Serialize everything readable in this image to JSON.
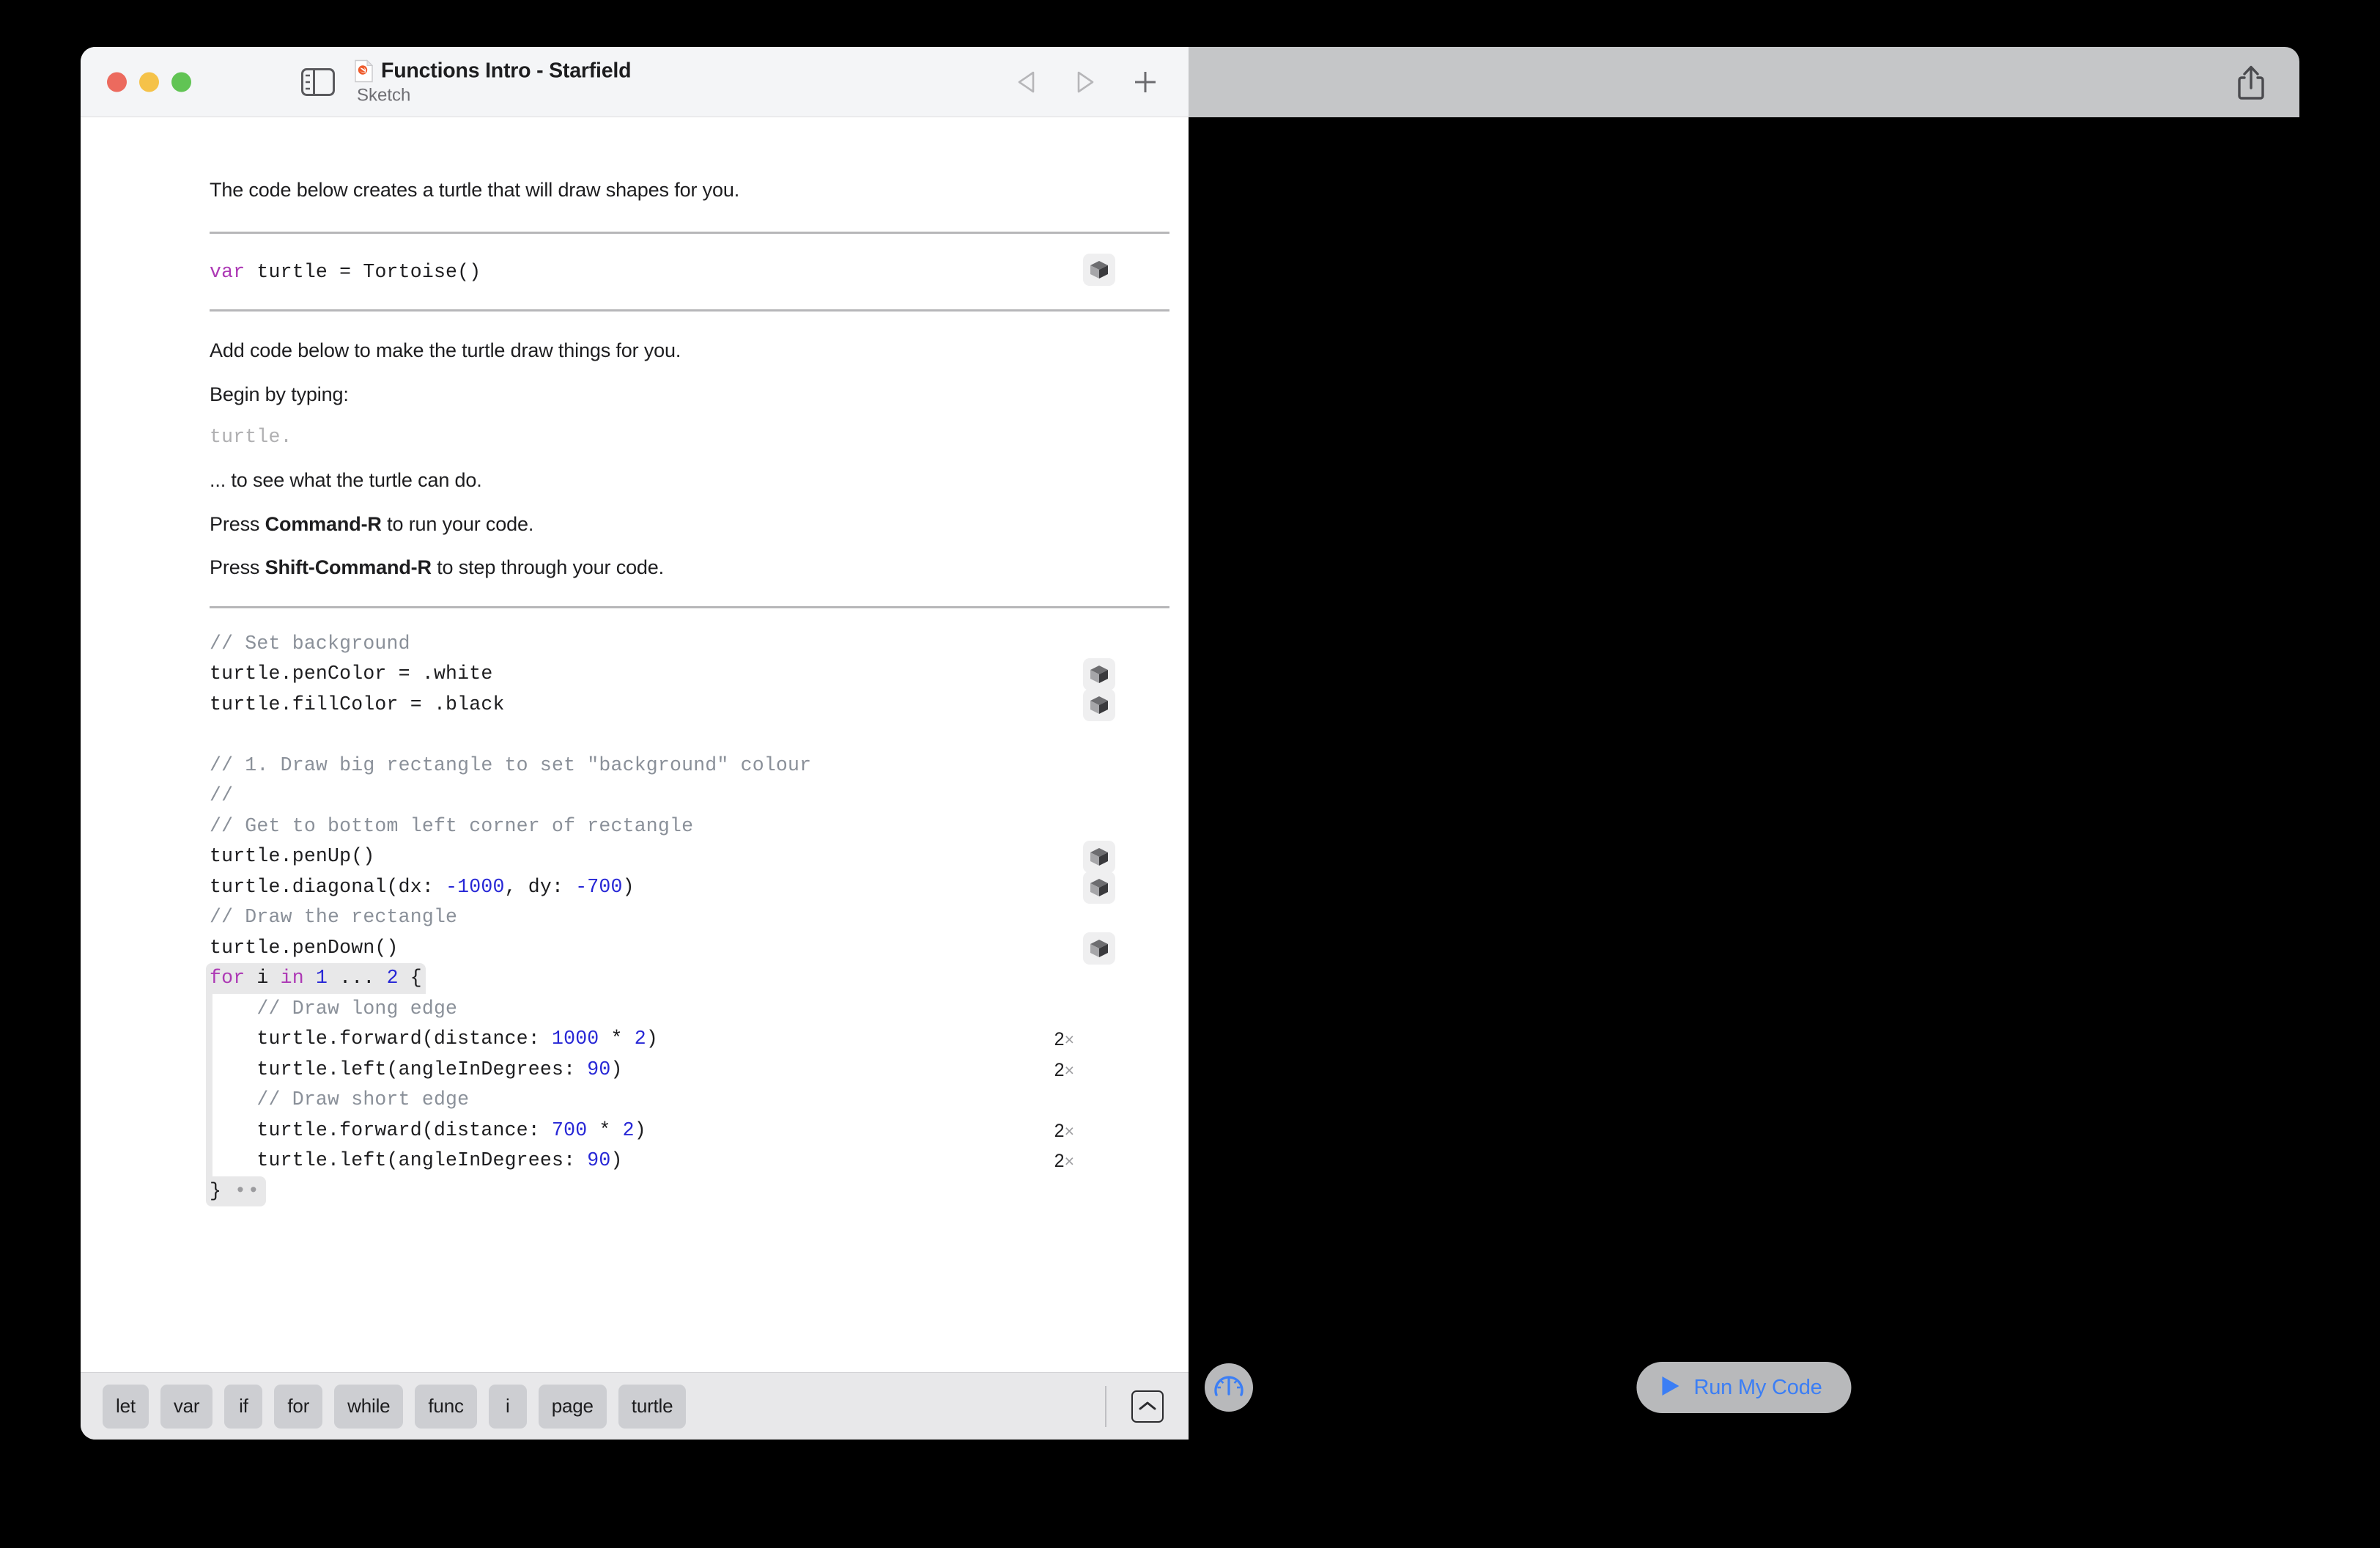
{
  "window": {
    "title": "Functions Intro - Starfield",
    "subtitle": "Sketch",
    "file_icon": "swift-file-icon",
    "traffic_lights": [
      {
        "name": "close",
        "color": "#ec6a5e"
      },
      {
        "name": "minimize",
        "color": "#f5c249"
      },
      {
        "name": "zoom",
        "color": "#61c454"
      }
    ],
    "sidebar_toggle_icon": "sidebar-toggle-icon",
    "nav": [
      {
        "name": "back-icon",
        "glyph": "triangle-left"
      },
      {
        "name": "forward-icon",
        "glyph": "triangle-right"
      },
      {
        "name": "add-icon",
        "glyph": "plus"
      }
    ]
  },
  "document": {
    "intro": "The code below creates a turtle that will draw shapes for you.",
    "setup_code": {
      "keyword": "var",
      "rest": " turtle = Tortoise()"
    },
    "instructions": [
      "Add code below to make the turtle draw things for you.",
      "Begin by typing:"
    ],
    "ghost_hint": "turtle.",
    "after_hint": "... to see what the turtle can do.",
    "run_hint": {
      "prefix": "Press ",
      "shortcut": "Command-R",
      "suffix": " to run your code."
    },
    "step_hint": {
      "prefix": "Press ",
      "shortcut": "Shift-Command-R",
      "suffix": " to step through your code."
    },
    "code_lines": [
      {
        "text": "// Set background",
        "type": "comment"
      },
      {
        "text": "turtle.penColor = .white",
        "type": "code",
        "result": true
      },
      {
        "text": "turtle.fillColor = .black",
        "type": "code",
        "result": true
      },
      {
        "text": "",
        "type": "blank"
      },
      {
        "text": "// 1. Draw big rectangle to set \"background\" colour",
        "type": "comment"
      },
      {
        "text": "//",
        "type": "comment"
      },
      {
        "text": "// Get to bottom left corner of rectangle",
        "type": "comment"
      },
      {
        "text": "turtle.penUp()",
        "type": "code",
        "result": true
      },
      {
        "text": "turtle.diagonal(dx: -1000, dy: -700)",
        "type": "code",
        "result": true
      },
      {
        "text": "// Draw the rectangle",
        "type": "comment"
      },
      {
        "text": "turtle.penDown()",
        "type": "code",
        "result": true
      }
    ],
    "loop": {
      "header": {
        "kw1": "for",
        "var": " i ",
        "kw2": "in",
        "n1": " 1 ",
        "dots": "... ",
        "n2": "2",
        "brace": " {"
      },
      "footer_brace": "}",
      "footer_dots": "••",
      "body": [
        {
          "text": "// Draw long edge",
          "type": "comment",
          "count": ""
        },
        {
          "text": "turtle.forward(distance: 1000 * 2)",
          "type": "code",
          "count": "2"
        },
        {
          "text": "turtle.left(angleInDegrees: 90)",
          "type": "code",
          "count": "2"
        },
        {
          "text": "// Draw short edge",
          "type": "comment",
          "count": ""
        },
        {
          "text": "turtle.forward(distance: 700 * 2)",
          "type": "code",
          "count": "2"
        },
        {
          "text": "turtle.left(angleInDegrees: 90)",
          "type": "code",
          "count": "2"
        }
      ],
      "count_suffix": "×"
    }
  },
  "shortcut_bar": {
    "chips": [
      "let",
      "var",
      "if",
      "for",
      "while",
      "func",
      "i",
      "page",
      "turtle"
    ],
    "hide_keyboard_icon": "hide-keyboard-icon"
  },
  "live_view": {
    "share_icon": "share-icon",
    "gauge_icon": "speed-gauge-icon",
    "run_label": "Run My Code",
    "run_icon": "play-icon"
  },
  "colors": {
    "keyword": "#ad39b5",
    "number": "#2727d6",
    "comment": "#8a9099",
    "accent_blue": "#3b7ef5",
    "panel_gray": "#c5c6c8"
  }
}
